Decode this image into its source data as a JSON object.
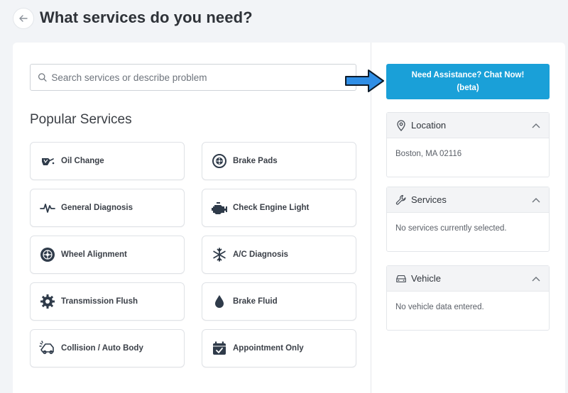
{
  "header": {
    "title": "What services do you need?"
  },
  "search": {
    "placeholder": "Search services or describe problem"
  },
  "popular": {
    "title": "Popular Services",
    "items": [
      {
        "label": "Oil Change",
        "icon": "oil-can-icon"
      },
      {
        "label": "Brake Pads",
        "icon": "brake-disc-icon"
      },
      {
        "label": "General Diagnosis",
        "icon": "pulse-icon"
      },
      {
        "label": "Check Engine Light",
        "icon": "engine-icon"
      },
      {
        "label": "Wheel Alignment",
        "icon": "wheel-icon"
      },
      {
        "label": "A/C Diagnosis",
        "icon": "snowflake-icon"
      },
      {
        "label": "Transmission Flush",
        "icon": "gear-icon"
      },
      {
        "label": "Brake Fluid",
        "icon": "drop-icon"
      },
      {
        "label": "Collision / Auto Body",
        "icon": "car-crash-icon"
      },
      {
        "label": "Appointment Only",
        "icon": "calendar-check-icon"
      }
    ]
  },
  "assist": {
    "line1": "Need Assistance? Chat Now!",
    "line2": "(beta)"
  },
  "panels": {
    "location": {
      "title": "Location",
      "value": "Boston, MA 02116"
    },
    "services": {
      "title": "Services",
      "value": "No services currently selected."
    },
    "vehicle": {
      "title": "Vehicle",
      "value": "No vehicle data entered."
    }
  },
  "colors": {
    "accent": "#1aa0d8",
    "arrow": "#2f8ee6"
  }
}
